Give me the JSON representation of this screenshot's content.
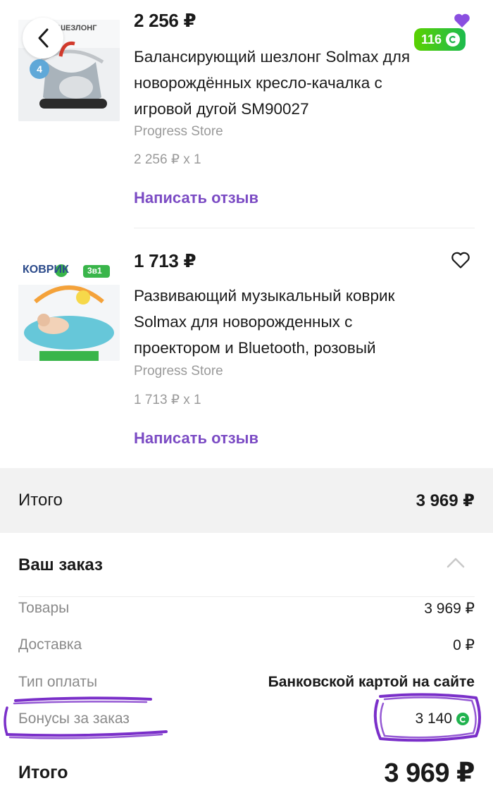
{
  "colors": {
    "accent_purple": "#7b4bc4",
    "bonus_green": "#21b34f",
    "annotation_purple": "#7a2fc9",
    "heart_filled": "#8a4fe0"
  },
  "products": [
    {
      "image_text": "ШЕЗЛОНГ",
      "price": "2 256 ₽",
      "title_lines": [
        "Балансирующий шезлонг Solmax для",
        "новорождённых кресло-качалка с",
        "игровой дугой SM90027"
      ],
      "store": "Progress Store",
      "qty": "2 256 ₽ x 1",
      "review_label": "Написать отзыв",
      "bonus_badge": "116",
      "favorite": true
    },
    {
      "image_text": "КОВРИК",
      "image_badge": "3в1",
      "price": "1 713 ₽",
      "title_lines": [
        "Развивающий музыкальный коврик",
        "Solmax для новорожденных с",
        "проектором и Bluetooth, розовый"
      ],
      "store": "Progress Store",
      "qty": "1 713 ₽ x 1",
      "review_label": "Написать отзыв",
      "favorite": false
    }
  ],
  "total_band": {
    "label": "Итого",
    "value": "3 969 ₽"
  },
  "order": {
    "header": "Ваш заказ",
    "rows": [
      {
        "label": "Товары",
        "value": "3 969 ₽"
      },
      {
        "label": "Доставка",
        "value": "0 ₽"
      },
      {
        "label": "Тип оплаты",
        "value": "Банковской картой на сайте"
      },
      {
        "label": "Бонусы за заказ",
        "value": "3 140"
      }
    ],
    "final_label": "Итого",
    "final_value": "3 969 ₽"
  }
}
